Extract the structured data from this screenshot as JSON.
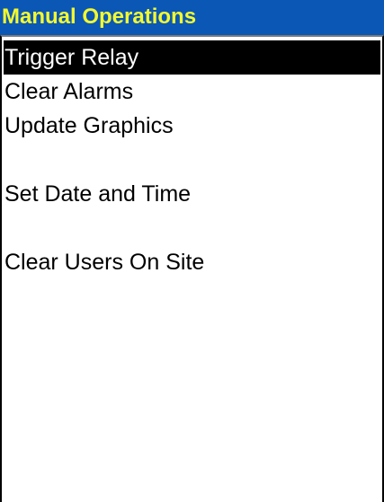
{
  "panel": {
    "title": "Manual Operations",
    "items": [
      {
        "label": "Trigger Relay",
        "selected": true
      },
      {
        "label": "Clear Alarms",
        "selected": false
      },
      {
        "label": "Update Graphics",
        "selected": false
      },
      {
        "label": "",
        "selected": false
      },
      {
        "label": "Set Date and Time",
        "selected": false
      },
      {
        "label": "",
        "selected": false
      },
      {
        "label": "Clear Users On Site",
        "selected": false
      }
    ]
  },
  "colors": {
    "title_background": "#0a57b6",
    "title_text": "#f3f82f",
    "selected_background": "#000000",
    "selected_text": "#ffffff"
  }
}
